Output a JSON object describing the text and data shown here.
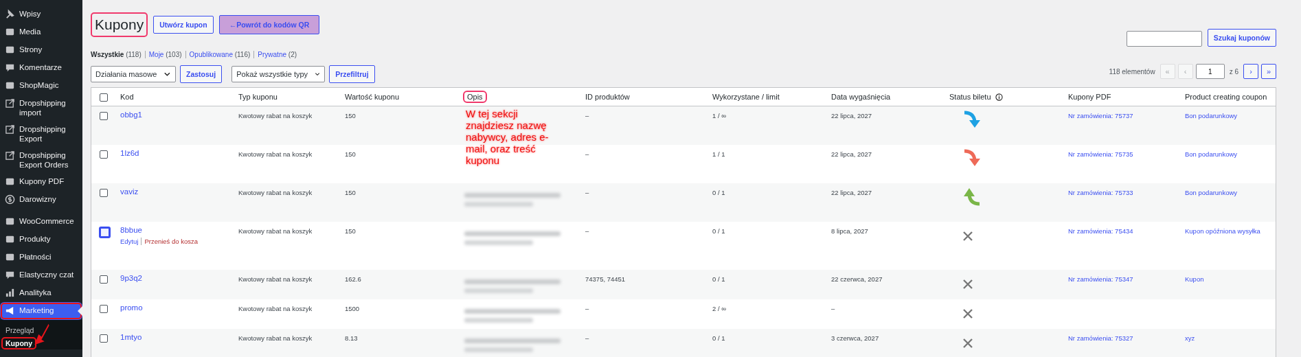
{
  "sidebar": {
    "items": [
      {
        "label": "Wpisy",
        "selected": false,
        "highlighted": false
      },
      {
        "label": "Media",
        "selected": false,
        "highlighted": false
      },
      {
        "label": "Strony",
        "selected": false,
        "highlighted": false
      },
      {
        "label": "Komentarze",
        "selected": false,
        "highlighted": false
      },
      {
        "label": "ShopMagic",
        "selected": false,
        "highlighted": false
      },
      {
        "label": "Dropshipping import",
        "selected": false,
        "highlighted": false
      },
      {
        "label": "Dropshipping Export",
        "selected": false,
        "highlighted": false
      },
      {
        "label": "Dropshipping Export Orders",
        "selected": false,
        "highlighted": false
      },
      {
        "label": "Kupony PDF",
        "selected": false,
        "highlighted": false
      },
      {
        "label": "Darowizny",
        "selected": false,
        "highlighted": false
      },
      {
        "label": "WooCommerce",
        "selected": false,
        "highlighted": false
      },
      {
        "label": "Produkty",
        "selected": false,
        "highlighted": false
      },
      {
        "label": "Płatności",
        "selected": false,
        "highlighted": false
      },
      {
        "label": "Elastyczny czat",
        "selected": false,
        "highlighted": false
      },
      {
        "label": "Analityka",
        "selected": false,
        "highlighted": false
      },
      {
        "label": "Marketing",
        "selected": true,
        "highlighted": true
      }
    ],
    "submenu": [
      {
        "label": "Przegląd",
        "selected": false,
        "highlighted": false
      },
      {
        "label": "Kupony",
        "selected": true,
        "highlighted": true
      }
    ]
  },
  "page": {
    "title": "Kupony",
    "title_highlighted": true,
    "buttons": [
      {
        "label": "Utwórz kupon",
        "kind": "plain"
      },
      {
        "label": "←Powrót do kodów QR",
        "kind": "accent"
      }
    ]
  },
  "filters": [
    {
      "label": "Wszystkie",
      "count": "(118)",
      "selected": true
    },
    {
      "label": "Moje",
      "count": "(103)",
      "selected": false
    },
    {
      "label": "Opublikowane",
      "count": "(116)",
      "selected": false
    },
    {
      "label": "Prywatne",
      "count": "(2)",
      "selected": false
    }
  ],
  "search": {
    "button": "Szukaj kuponów"
  },
  "bulk": {
    "select": "Działania masowe",
    "apply": "Zastosuj",
    "type_select": "Pokaż wszystkie typy",
    "filter": "Przefiltruj"
  },
  "pagination": {
    "count": "118 elementów",
    "first": "«",
    "prev": "‹",
    "page": "1",
    "of": "z 6",
    "next": "›",
    "last": "»",
    "first_disabled": true,
    "prev_disabled": true,
    "next_disabled": false,
    "last_disabled": false
  },
  "table": {
    "select_all_checked": false,
    "columns": [
      {
        "label": "Kod",
        "highlighted": false
      },
      {
        "label": "Typ kuponu",
        "highlighted": false
      },
      {
        "label": "Wartość kuponu",
        "highlighted": false
      },
      {
        "label": "Opis",
        "highlighted": true
      },
      {
        "label": "ID produktów",
        "highlighted": false
      },
      {
        "label": "Wykorzystane / limit",
        "highlighted": false
      },
      {
        "label": "Data wygaśnięcia",
        "highlighted": false
      },
      {
        "label": "Status biletu",
        "highlighted": false,
        "info": true
      },
      {
        "label": "Kupony PDF",
        "highlighted": false
      },
      {
        "label": "Product creating coupon",
        "highlighted": false
      }
    ],
    "rows": [
      {
        "code": "obbg1",
        "type": "Kwotowy rabat na koszyk",
        "value": "150",
        "products": "–",
        "usage": "1 / ∞",
        "expiry": "22 lipca, 2027",
        "status": {
          "kind": "arrow-down",
          "color": "#1ea1e3"
        },
        "pdf": "Nr zamówienia: 75737",
        "product": "Bon podarunkowy",
        "checked": false,
        "focused": false,
        "actions": []
      },
      {
        "code": "1lz6d",
        "type": "Kwotowy rabat na koszyk",
        "value": "150",
        "products": "–",
        "usage": "1 / 1",
        "expiry": "22 lipca, 2027",
        "status": {
          "kind": "arrow-down",
          "color": "#ee6a58"
        },
        "pdf": "Nr zamówienia: 75735",
        "product": "Bon podarunkowy",
        "checked": false,
        "focused": false,
        "actions": []
      },
      {
        "code": "vaviz",
        "type": "Kwotowy rabat na koszyk",
        "value": "150",
        "description": {
          "kind": "blurred"
        },
        "products": "–",
        "usage": "0 / 1",
        "expiry": "22 lipca, 2027",
        "status": {
          "kind": "arrow-up",
          "color": "#7ab648"
        },
        "pdf": "Nr zamówienia: 75733",
        "product": "Bon podarunkowy",
        "checked": false,
        "focused": false,
        "actions": []
      },
      {
        "code": "8bbue",
        "type": "Kwotowy rabat na koszyk",
        "value": "150",
        "description": {
          "kind": "blurred"
        },
        "products": "–",
        "usage": "0 / 1",
        "expiry": "8 lipca, 2027",
        "status": {
          "kind": "cross",
          "color": "#777777"
        },
        "pdf": "Nr zamówienia: 75434",
        "product": "Kupon opóźniona wysyłka",
        "checked": false,
        "focused": true,
        "actions": [
          {
            "label": "Edytuj",
            "kind": "edit"
          },
          {
            "label": "Przenieś do kosza",
            "kind": "trash"
          }
        ]
      },
      {
        "code": "9p3q2",
        "type": "Kwotowy rabat na koszyk",
        "value": "162.6",
        "description": {
          "kind": "blurred"
        },
        "products": "74375, 74451",
        "usage": "0 / 1",
        "expiry": "22 czerwca, 2027",
        "status": {
          "kind": "cross",
          "color": "#777777"
        },
        "pdf": "Nr zamówienia: 75347",
        "product": "Kupon",
        "checked": false,
        "focused": false,
        "actions": []
      },
      {
        "code": "promo",
        "type": "Kwotowy rabat na koszyk",
        "value": "1500",
        "description": {
          "kind": "blurred"
        },
        "products": "–",
        "usage": "2 / ∞",
        "expiry": "–",
        "status": {
          "kind": "cross",
          "color": "#777777"
        },
        "checked": false,
        "focused": false,
        "actions": []
      },
      {
        "code": "1mtyo",
        "type": "Kwotowy rabat na koszyk",
        "value": "8.13",
        "description": {
          "kind": "blurred"
        },
        "products": "–",
        "usage": "0 / 1",
        "expiry": "3 czerwca, 2027",
        "status": {
          "kind": "cross",
          "color": "#777777"
        },
        "pdf": "Nr zamówienia: 75327",
        "product": "xyz",
        "checked": false,
        "focused": false,
        "actions": []
      }
    ]
  },
  "annotation": {
    "text": "W tej sekcji znajdziesz nazwę nabywcy, adres e-mail, oraz treść kuponu",
    "arrow": true
  }
}
